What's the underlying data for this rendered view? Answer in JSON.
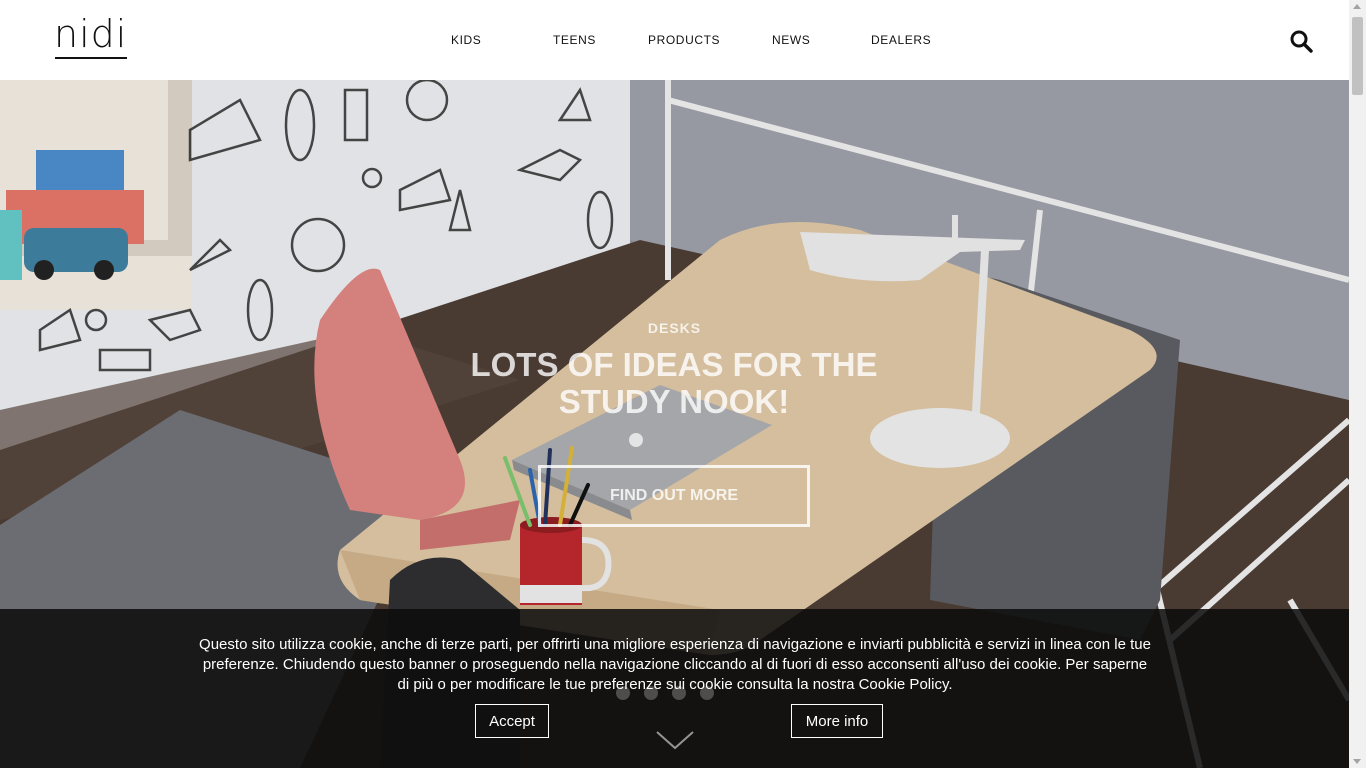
{
  "header": {
    "logo": "nidi",
    "nav": [
      {
        "label": "KIDS"
      },
      {
        "label": "TEENS"
      },
      {
        "label": "PRODUCTS"
      },
      {
        "label": "NEWS"
      },
      {
        "label": "DEALERS"
      }
    ],
    "search_icon": "search-icon"
  },
  "hero": {
    "subtitle": "DESKS",
    "title": "LOTS OF IDEAS FOR THE STUDY NOOK!",
    "button": "FIND OUT MORE",
    "slide_count": 4,
    "scroll_icon": "chevron-down-icon"
  },
  "cookie": {
    "text": "Questo sito utilizza cookie, anche di terze parti, per offrirti una migliore esperienza di navigazione e inviarti pubblicità e servizi in linea con le tue preferenze. Chiudendo questo banner o proseguendo nella navigazione cliccando al di fuori di esso acconsenti all'uso dei cookie. Per saperne di più o per modificare le tue preferenze sui cookie consulta la nostra Cookie Policy.",
    "accept": "Accept",
    "more_info": "More info"
  },
  "colors": {
    "wall": "#9a9ca5",
    "floor": "#4a3b33",
    "desk_top": "#d8c1a0",
    "desk_body": "#5b5c61",
    "chair": "#d98580",
    "cookie_bg": "#0c0c0c"
  }
}
